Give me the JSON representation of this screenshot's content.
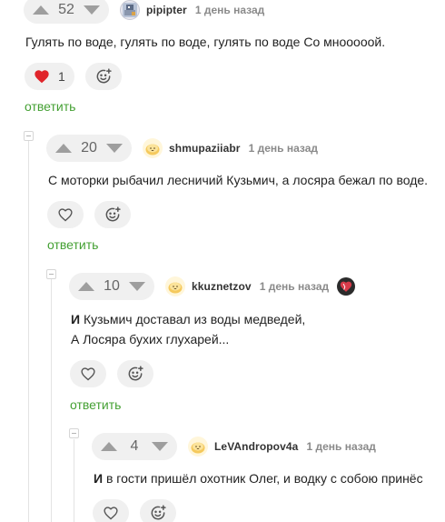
{
  "comments": [
    {
      "rating": "52",
      "username": "pipipter",
      "time": "1 день назад",
      "text_lines": [
        "Гулять по воде, гулять по воде, гулять по воде Со мнооооой."
      ],
      "likes": "1",
      "liked": true,
      "reply_label": "ответить",
      "avatar_icon": "pixel-avatar-icon"
    },
    {
      "rating": "20",
      "username": "shmupaziiabr",
      "time": "1 день назад",
      "text_lines": [
        "С моторки рыбачил лесничий Кузьмич, а лосяра бежал по воде."
      ],
      "likes": "",
      "liked": false,
      "reply_label": "ответить",
      "avatar_icon": "bun-avatar-icon"
    },
    {
      "rating": "10",
      "username": "kkuznetzov",
      "time": "1 день назад",
      "text_lines": [
        "И Кузьмич доставал из воды медведей,",
        "А Лосяра бухих глухарей..."
      ],
      "likes": "",
      "liked": false,
      "reply_label": "ответить",
      "avatar_icon": "bun-avatar-icon",
      "badge_icon": "heart-badge-icon"
    },
    {
      "rating": "4",
      "username": "LeVAndropov4a",
      "time": "1 день назад",
      "text_lines": [
        "И в гости пришёл охотник Олег, и водку с собою принёс"
      ],
      "likes": "",
      "liked": false,
      "avatar_icon": "bun-avatar-icon"
    }
  ],
  "colors": {
    "reply_green": "#44a033",
    "heart_red": "#e0252b",
    "pill_bg": "#f0f0f0",
    "thread_line": "#e3e3e3"
  }
}
